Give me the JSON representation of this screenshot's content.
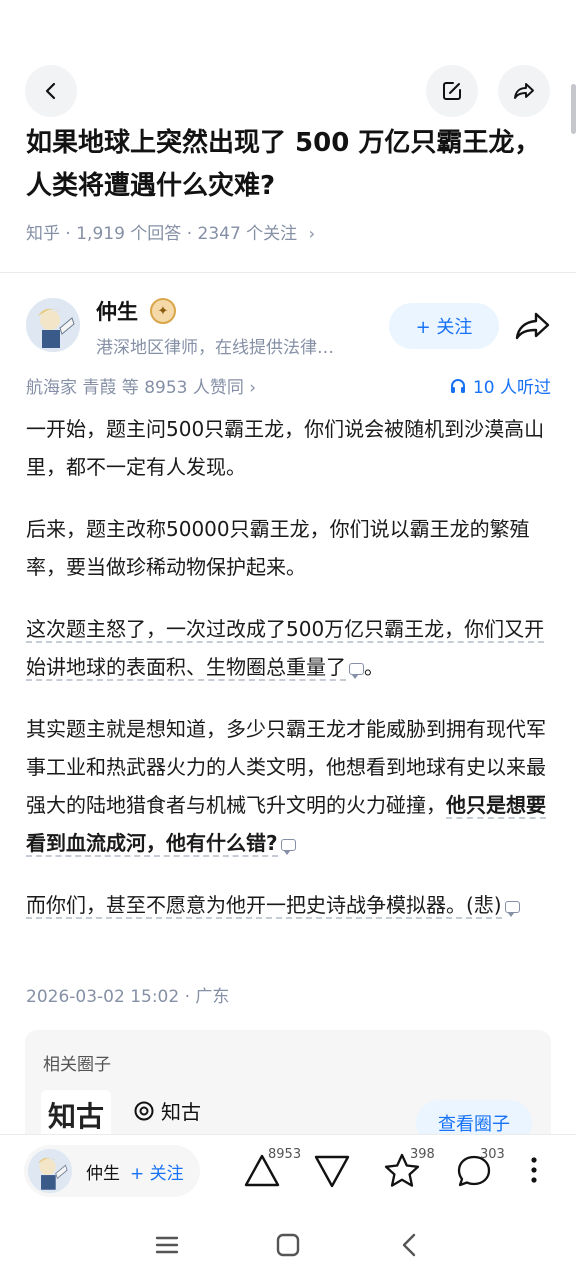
{
  "topbar": {
    "back_icon": "chevron-left-icon",
    "edit_icon": "edit-icon",
    "share_icon": "share-icon"
  },
  "question": {
    "title": "如果地球上突然出现了 500 万亿只霸王龙，人类将遭遇什么灾难?",
    "source": "知乎",
    "answers": "1,919 个回答",
    "followers": "2347 个关注",
    "chevron": "›"
  },
  "author": {
    "name": "仲生",
    "badge_icon": "medal-icon",
    "description": "港深地区律师，在线提供法律…",
    "follow_label": "+ 关注"
  },
  "stats": {
    "likers": "航海家  青葭 等 8953 人赞同 ›",
    "listeners": "10 人听过"
  },
  "content": {
    "p1": "一开始，题主问500只霸王龙，你们说会被随机到沙漠高山里，都不一定有人发现。",
    "p2": "后来，题主改称50000只霸王龙，你们说以霸王龙的繁殖率，要当做珍稀动物保护起来。",
    "p3": "这次题主怒了，一次过改成了500万亿只霸王龙，你们又开始讲地球的表面积、生物圈总重量了",
    "p3_end": "。",
    "p4_plain": "其实题主就是想知道，多少只霸王龙才能威胁到拥有现代军事工业和热武器火力的人类文明，他想看到地球有史以来最强大的陆地猎食者与机械飞升文明的火力碰撞，",
    "p4_bold": "他只是想要看到血流成河，他有什么错?",
    "p5": "而你们，甚至不愿意为他开一把史诗战争模拟器。(悲)"
  },
  "post_time": "2026-03-02 15:02 · 广东",
  "circle": {
    "section_label": "相关圈子",
    "logo_text": "知古",
    "name": "知古",
    "button_label": "查看圈子"
  },
  "bottom_bar": {
    "author_name": "仲生",
    "follow_label": "+ 关注",
    "upvote_count": "8953",
    "star_count": "398",
    "comment_count": "303"
  },
  "colors": {
    "accent": "#1772f6",
    "muted": "#8590a6",
    "follow_bg": "#ebf5ff"
  }
}
